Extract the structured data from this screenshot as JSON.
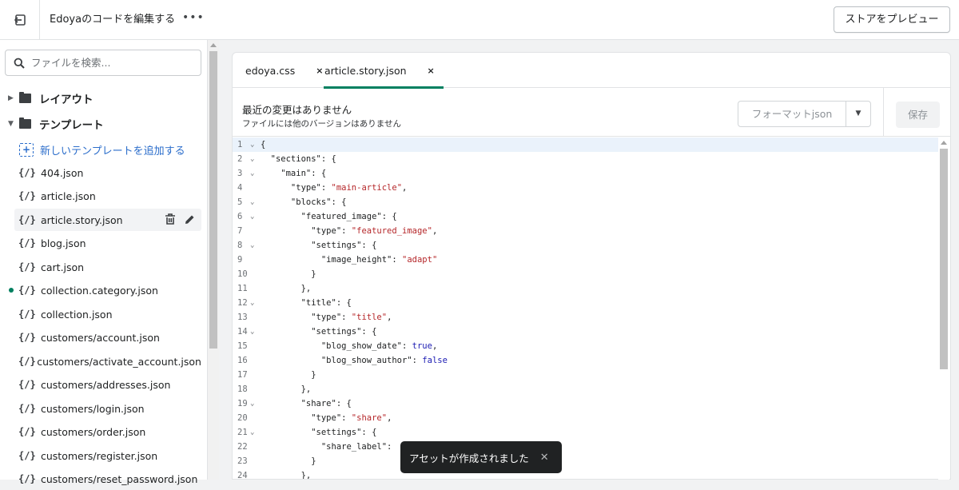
{
  "topbar": {
    "title": "Edoyaのコードを編集する",
    "more": "•••",
    "preview_label": "ストアをプレビュー"
  },
  "sidebar": {
    "search_placeholder": "ファイルを検索...",
    "folders": [
      "レイアウト",
      "テンプレート"
    ],
    "add_template": "新しいテンプレートを追加する",
    "files": [
      "404.json",
      "article.json",
      "article.story.json",
      "blog.json",
      "cart.json",
      "collection.category.json",
      "collection.json",
      "customers/account.json",
      "customers/activate_account.json",
      "customers/addresses.json",
      "customers/login.json",
      "customers/order.json",
      "customers/register.json",
      "customers/reset_password.json"
    ],
    "code_icon": "{/}"
  },
  "editor": {
    "tabs": [
      {
        "label": "edoya.css",
        "close": "×"
      },
      {
        "label": "article.story.json",
        "close": "×"
      }
    ],
    "info_title": "最近の変更はありません",
    "info_sub": "ファイルには他のバージョンはありません",
    "format_label": "フォーマットjson",
    "save_label": "保存",
    "lines": [
      {
        "n": "1",
        "t": "{"
      },
      {
        "n": "2",
        "t": "  \"sections\": {"
      },
      {
        "n": "3",
        "t": "    \"main\": {"
      },
      {
        "n": "4",
        "t": "      \"type\": \"main-article\","
      },
      {
        "n": "5",
        "t": "      \"blocks\": {"
      },
      {
        "n": "6",
        "t": "        \"featured_image\": {"
      },
      {
        "n": "7",
        "t": "          \"type\": \"featured_image\","
      },
      {
        "n": "8",
        "t": "          \"settings\": {"
      },
      {
        "n": "9",
        "t": "            \"image_height\": \"adapt\""
      },
      {
        "n": "10",
        "t": "          }"
      },
      {
        "n": "11",
        "t": "        },"
      },
      {
        "n": "12",
        "t": "        \"title\": {"
      },
      {
        "n": "13",
        "t": "          \"type\": \"title\","
      },
      {
        "n": "14",
        "t": "          \"settings\": {"
      },
      {
        "n": "15",
        "t": "            \"blog_show_date\": true,"
      },
      {
        "n": "16",
        "t": "            \"blog_show_author\": false"
      },
      {
        "n": "17",
        "t": "          }"
      },
      {
        "n": "18",
        "t": "        },"
      },
      {
        "n": "19",
        "t": "        \"share\": {"
      },
      {
        "n": "20",
        "t": "          \"type\": \"share\","
      },
      {
        "n": "21",
        "t": "          \"settings\": {"
      },
      {
        "n": "22",
        "t": "            \"share_label\": "
      },
      {
        "n": "23",
        "t": "          }"
      },
      {
        "n": "24",
        "t": "        },"
      }
    ]
  },
  "toast": {
    "message": "アセットが作成されました",
    "close": "✕"
  }
}
